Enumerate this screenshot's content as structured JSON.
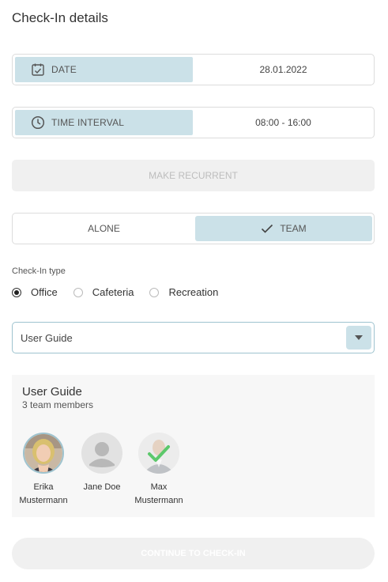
{
  "page": {
    "title": "Check-In details"
  },
  "date": {
    "label": "DATE",
    "value": "28.01.2022",
    "icon": "calendar-check-icon"
  },
  "time": {
    "label": "TIME INTERVAL",
    "value": "08:00 - 16:00",
    "icon": "clock-icon"
  },
  "recurrent": {
    "label": "MAKE RECURRENT",
    "state": "disabled"
  },
  "mode": {
    "alone_label": "ALONE",
    "team_label": "TEAM",
    "selected": "TEAM"
  },
  "checkin_type": {
    "label": "Check-In type",
    "options": [
      {
        "label": "Office",
        "selected": true
      },
      {
        "label": "Cafeteria",
        "selected": false
      },
      {
        "label": "Recreation",
        "selected": false
      }
    ]
  },
  "team_select": {
    "value": "User Guide",
    "icon": "chevron-down-icon"
  },
  "team": {
    "name": "User Guide",
    "count_text": "3 team members",
    "members": [
      {
        "name": "Erika Mustermann",
        "avatar": "photo"
      },
      {
        "name": "Jane Doe",
        "avatar": "placeholder"
      },
      {
        "name": "Max Mustermann",
        "avatar": "photo-checked"
      }
    ]
  },
  "continue_button": {
    "label": "CONTINUE TO CHECK-IN",
    "state": "disabled"
  },
  "colors": {
    "accent": "#cbe1e8",
    "check": "#5cc86b",
    "disabled_bg": "#f0f0f0"
  }
}
